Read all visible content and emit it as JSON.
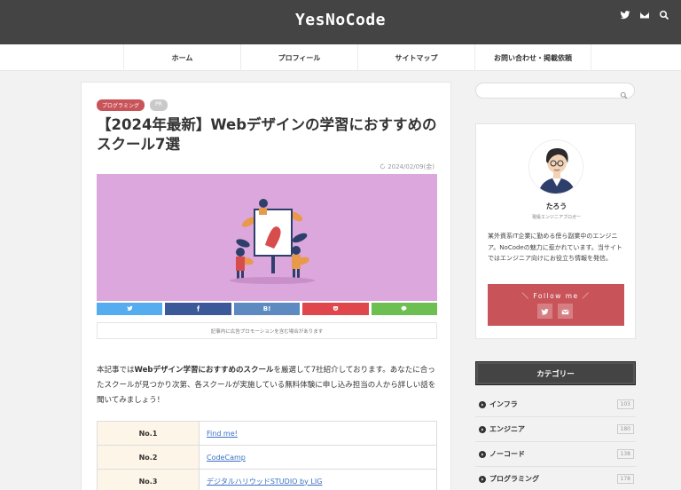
{
  "header": {
    "logo": "YesNoCode",
    "icons": [
      "twitter-icon",
      "mail-icon",
      "search-icon"
    ]
  },
  "nav": {
    "items": [
      "ホーム",
      "プロフィール",
      "サイトマップ",
      "お問い合わせ・掲載依頼"
    ]
  },
  "article": {
    "tags": [
      "プログラミング",
      "PR"
    ],
    "title": "【2024年最新】Webデザインの学習におすすめのスクール7選",
    "date": "2024/02/09(金)",
    "share": {
      "twitter_color": "#55acee",
      "facebook_color": "#3b5998",
      "hatena_label": "B!",
      "hatena_color": "#5d8ac1",
      "pocket_color": "#e0474c",
      "line_color": "#6cbf50"
    },
    "promo_notice": "記事内に広告プロモーションを含む場合があります",
    "intro": {
      "part1": "本記事では",
      "bold1": "Webデザイン学習におすすめのスクール",
      "part2": "を厳選して7社紹介しております。あなたに合ったスクールが見つかり次第、各スクールが実施している無料体験に申し込み担当の人から詳しい話を聞いてみましょう！"
    },
    "table": [
      {
        "no": "No.1",
        "name": "Find me!"
      },
      {
        "no": "No.2",
        "name": "CodeCamp"
      },
      {
        "no": "No.3",
        "name": "デジタルハリウッドSTUDIO by LIG"
      }
    ]
  },
  "sidebar": {
    "search": {
      "placeholder": ""
    },
    "profile": {
      "name": "たろう",
      "role": "現役エンジニアブロガー",
      "description": "某外資系IT企業に勤める傍ら副業中のエンジニア。NoCodeの魅力に惹かれています。当サイトではエンジニア向けにお役立ち情報を発信。",
      "follow_label": "＼ Follow me ／",
      "accent_color": "#c8545a"
    },
    "categories_title": "カテゴリー",
    "categories": [
      {
        "name": "インフラ",
        "count": "103"
      },
      {
        "name": "エンジニア",
        "count": "180"
      },
      {
        "name": "ノーコード",
        "count": "138"
      },
      {
        "name": "プログラミング",
        "count": "178"
      }
    ]
  }
}
